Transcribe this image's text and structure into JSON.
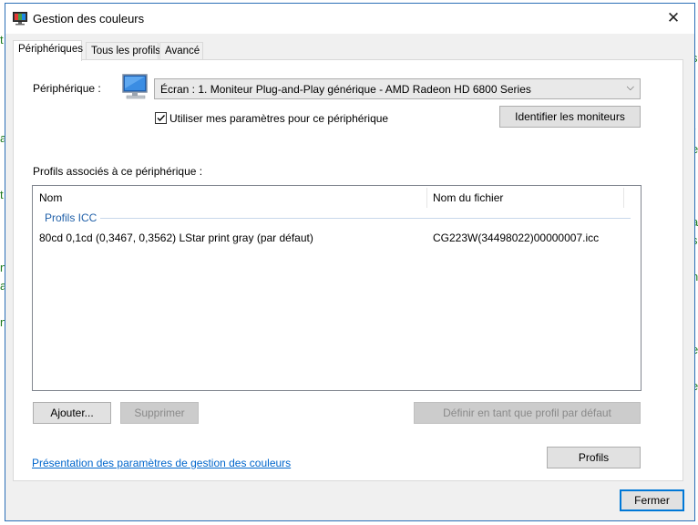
{
  "background": {
    "left_chars": [
      "t",
      "a",
      "t",
      "n",
      "a",
      "n"
    ],
    "right_chars": [
      "t",
      "s",
      "r",
      "e",
      "a",
      "s",
      "n",
      "e",
      "e"
    ]
  },
  "window": {
    "title": "Gestion des couleurs",
    "close_glyph": "✕"
  },
  "tabs": [
    {
      "label": "Périphériques",
      "active": true
    },
    {
      "label": "Tous les profils",
      "active": false
    },
    {
      "label": "Avancé",
      "active": false
    }
  ],
  "device": {
    "label": "Périphérique :",
    "selected": "Écran : 1. Moniteur Plug-and-Play générique - AMD Radeon HD 6800 Series",
    "chevron": "⌵",
    "checkbox_label": "Utiliser mes paramètres pour ce périphérique",
    "checkbox_checked": true,
    "identify_button": "Identifier les moniteurs"
  },
  "profiles": {
    "label": "Profils associés à ce périphérique :",
    "columns": [
      "Nom",
      "Nom du fichier"
    ],
    "group": "Profils ICC",
    "rows": [
      {
        "name": "80cd 0,1cd  (0,3467, 0,3562) LStar print gray (par défaut)",
        "file": "CG223W(34498022)00000007.icc"
      }
    ]
  },
  "buttons": {
    "add": "Ajouter...",
    "remove": "Supprimer",
    "set_default": "Définir en tant que profil par défaut",
    "profiles": "Profils",
    "close": "Fermer"
  },
  "link": "Présentation des paramètres de gestion des couleurs",
  "colors": {
    "accent": "#0078d7",
    "link": "#0066cc",
    "group_header": "#1f5fa8",
    "background_text": "#1e7b1e"
  }
}
